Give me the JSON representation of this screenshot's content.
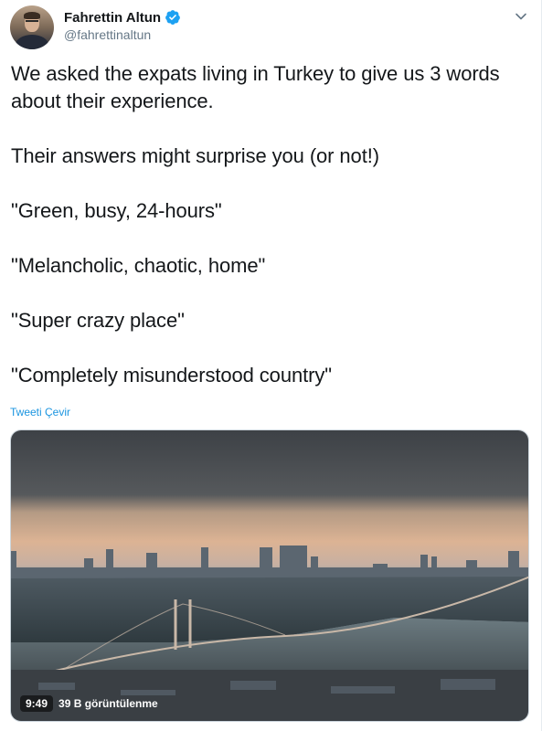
{
  "author": {
    "name": "Fahrettin Altun",
    "handle": "@fahrettinaltun",
    "verified": true
  },
  "tweet": {
    "lines": [
      "We asked the expats living in Turkey to give us 3 words about their experience.",
      "Their answers might surprise you (or not!)",
      "\"Green, busy, 24-hours\"",
      "\"Melancholic, chaotic, home\"",
      "\"Super crazy place\"",
      "\"Completely misunderstood country\""
    ],
    "translate_label": "Tweeti Çevir"
  },
  "media": {
    "duration": "9:49",
    "views": "39 B görüntülenme"
  },
  "icons": {
    "verified": "verified-badge-icon",
    "menu": "chevron-down-icon"
  },
  "colors": {
    "link": "#1b95e0",
    "verified": "#1da1f2",
    "secondary_text": "#657786"
  }
}
